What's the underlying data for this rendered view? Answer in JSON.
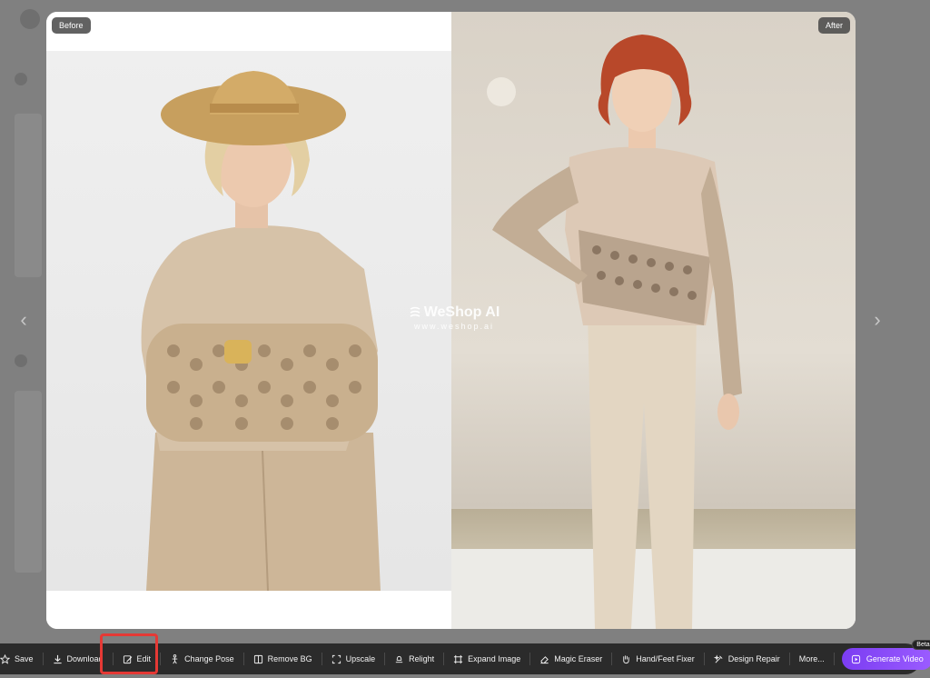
{
  "viewer": {
    "before_label": "Before",
    "after_label": "After",
    "watermark_brand": "WeShop AI",
    "watermark_url": "www.weshop.ai",
    "prev_arrow": "‹",
    "next_arrow": "›"
  },
  "toolbar": {
    "tools": [
      {
        "label": "Save",
        "icon": "star-icon"
      },
      {
        "label": "Download",
        "icon": "download-icon"
      },
      {
        "label": "Edit",
        "icon": "edit-icon"
      },
      {
        "label": "Change Pose",
        "icon": "pose-icon"
      },
      {
        "label": "Remove BG",
        "icon": "remove-bg-icon"
      },
      {
        "label": "Upscale",
        "icon": "upscale-icon"
      },
      {
        "label": "Relight",
        "icon": "relight-icon"
      },
      {
        "label": "Expand Image",
        "icon": "expand-icon"
      },
      {
        "label": "Magic Eraser",
        "icon": "eraser-icon"
      },
      {
        "label": "Hand/Feet Fixer",
        "icon": "hand-icon"
      },
      {
        "label": "Design Repair",
        "icon": "design-repair-icon"
      },
      {
        "label": "More...",
        "icon": ""
      }
    ],
    "generate_video": {
      "label": "Generate Video",
      "badge": "Beta"
    }
  },
  "colors": {
    "accent": "#8b4cf7",
    "highlight": "#e53935",
    "toolbar_bg": "#2b2b2b"
  }
}
